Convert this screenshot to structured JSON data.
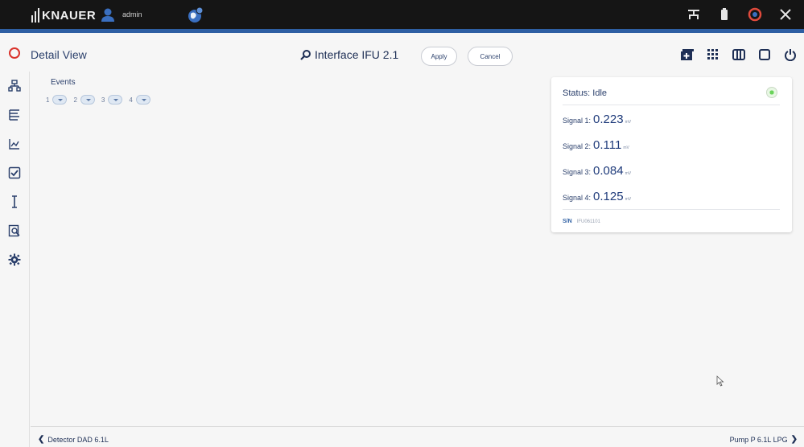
{
  "topbar": {
    "brand": "KNAUER",
    "user": "admin",
    "icons": [
      "user-icon",
      "globe-network-icon",
      "network-icon",
      "battery-icon",
      "status-ring-icon",
      "close-icon"
    ]
  },
  "header": {
    "title": "Detail View",
    "device_name": "Interface IFU 2.1",
    "apply_label": "Apply",
    "cancel_label": "Cancel",
    "view_icons": [
      "add-window-icon",
      "grid-view-icon",
      "columns-view-icon",
      "single-view-icon",
      "power-icon"
    ]
  },
  "sidebar": {
    "items": [
      "network-devices-icon",
      "method-tree-icon",
      "chart-icon",
      "checklist-icon",
      "text-cursor-icon",
      "search-doc-icon",
      "settings-gear-icon"
    ]
  },
  "events": {
    "label": "Events",
    "items": [
      {
        "num": "1"
      },
      {
        "num": "2"
      },
      {
        "num": "3"
      },
      {
        "num": "4"
      }
    ]
  },
  "status": {
    "title": "Status: Idle",
    "signals": [
      {
        "label": "Signal 1:",
        "value": "0.223",
        "unit": "mV"
      },
      {
        "label": "Signal 2:",
        "value": "0.111",
        "unit": "mV"
      },
      {
        "label": "Signal 3:",
        "value": "0.084",
        "unit": "mV"
      },
      {
        "label": "Signal 4:",
        "value": "0.125",
        "unit": "mV"
      }
    ],
    "sn_label": "S/N",
    "sn_value": "IFU061101"
  },
  "footer": {
    "prev": "Detector DAD 6.1L",
    "next": "Pump P 6.1L LPG"
  },
  "colors": {
    "accent_blue": "#2e5fa3",
    "brand_red": "#d9322b",
    "topbar": "#151515",
    "led_green": "#6ad35a"
  }
}
